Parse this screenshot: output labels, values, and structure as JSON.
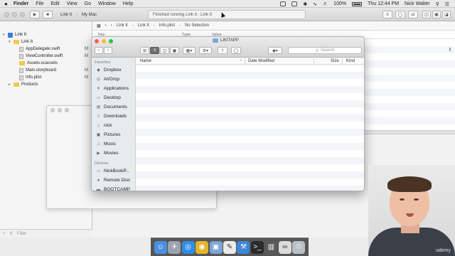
{
  "menubar": {
    "apple": "",
    "items": [
      "Finder",
      "File",
      "Edit",
      "View",
      "Go",
      "Window",
      "Help"
    ],
    "battery": "100%",
    "clock": "Thu 12:44 PM",
    "user": "Nick Walter"
  },
  "xcode": {
    "scheme_project": "Link It",
    "scheme_device": "My Mac",
    "activity": "Finished running Link It : Link It",
    "jumpbar": [
      "Link It",
      "Link It",
      "Info.plist",
      "No Selection"
    ],
    "plist_columns": [
      "Key",
      "Type",
      "Value"
    ],
    "navigator": [
      {
        "label": "Link It",
        "kind": "proj",
        "indent": 0,
        "badge": ""
      },
      {
        "label": "Link It",
        "kind": "folder",
        "indent": 1,
        "badge": ""
      },
      {
        "label": "AppDelegate.swift",
        "kind": "file",
        "indent": 2,
        "badge": "M"
      },
      {
        "label": "ViewController.swift",
        "kind": "file",
        "indent": 2,
        "badge": "M"
      },
      {
        "label": "Assets.xcassets",
        "kind": "folder",
        "indent": 2,
        "badge": ""
      },
      {
        "label": "Main.storyboard",
        "kind": "file",
        "indent": 2,
        "badge": "M"
      },
      {
        "label": "Info.plist",
        "kind": "file",
        "indent": 2,
        "badge": "M"
      },
      {
        "label": "Products",
        "kind": "folder",
        "indent": 1,
        "badge": ""
      }
    ],
    "filter_placeholder": "Filter"
  },
  "finder": {
    "window_title": "LIKITAPP",
    "search_placeholder": "Search",
    "columns": [
      "Name",
      "Date Modified",
      "Size",
      "Kind"
    ],
    "sections": [
      {
        "title": "Favorites",
        "items": [
          {
            "label": "Dropbox",
            "icon": "dropbox-icon"
          },
          {
            "label": "AirDrop",
            "icon": "airdrop-icon"
          },
          {
            "label": "Applications",
            "icon": "applications-icon"
          },
          {
            "label": "Desktop",
            "icon": "desktop-icon"
          },
          {
            "label": "Documents",
            "icon": "documents-icon"
          },
          {
            "label": "Downloads",
            "icon": "downloads-icon"
          },
          {
            "label": "nick",
            "icon": "home-icon"
          },
          {
            "label": "Pictures",
            "icon": "pictures-icon"
          },
          {
            "label": "Music",
            "icon": "music-icon"
          },
          {
            "label": "Movies",
            "icon": "movies-icon"
          }
        ]
      },
      {
        "title": "Devices",
        "items": [
          {
            "label": "NickBookP...",
            "icon": "laptop-icon"
          },
          {
            "label": "Remote Disc",
            "icon": "disc-icon"
          },
          {
            "label": "BOOTCAMP",
            "icon": "drive-icon"
          }
        ]
      }
    ]
  },
  "dock": [
    "finder-icon",
    "launchpad-icon",
    "safari-icon",
    "chrome-icon",
    "preview-icon",
    "textedit-icon",
    "xcode-icon",
    "terminal-icon",
    "sidebar-app-icon",
    "link-it-icon",
    "trash-icon"
  ],
  "webcam": {
    "watermark": "udemy"
  }
}
